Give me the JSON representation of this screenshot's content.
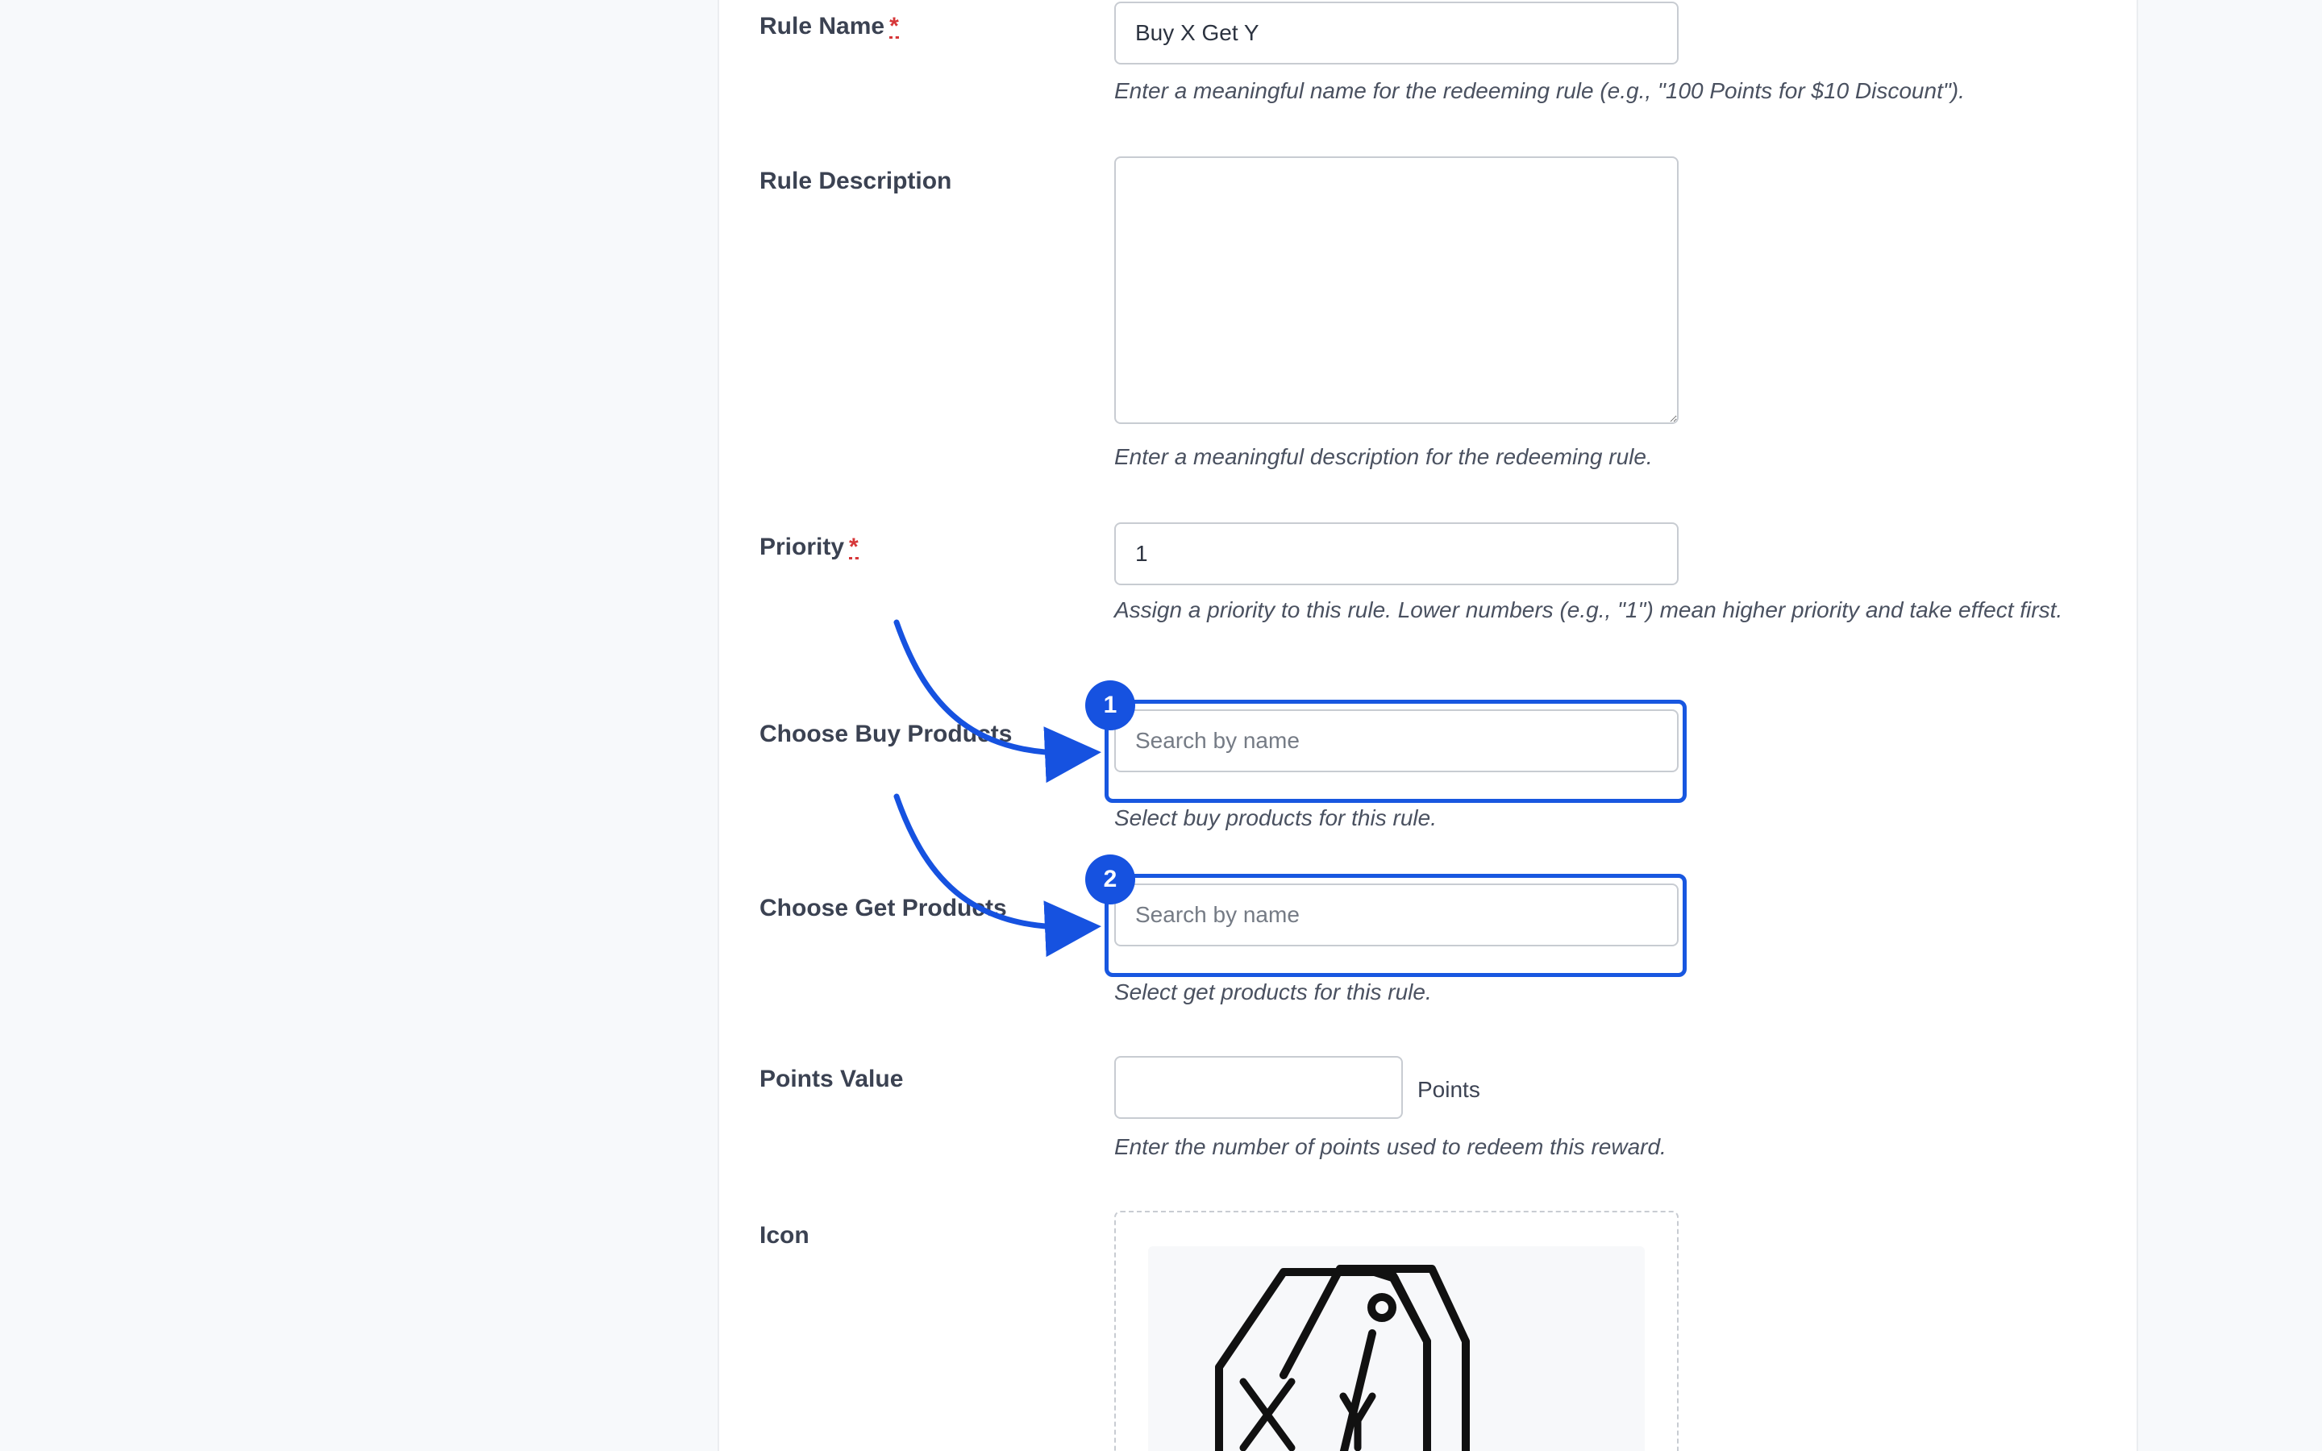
{
  "form": {
    "rule_name": {
      "label": "Rule Name",
      "required_mark": "*",
      "value": "Buy X Get Y",
      "help": "Enter a meaningful name for the redeeming rule (e.g., \"100 Points for $10 Discount\")."
    },
    "rule_description": {
      "label": "Rule Description",
      "value": "",
      "help": "Enter a meaningful description for the redeeming rule."
    },
    "priority": {
      "label": "Priority",
      "required_mark": "*",
      "value": "1",
      "help": "Assign a priority to this rule. Lower numbers (e.g., \"1\") mean higher priority and take effect first."
    },
    "buy_products": {
      "label": "Choose Buy Products",
      "placeholder": "Search by name",
      "help": "Select buy products for this rule.",
      "step_number": "1"
    },
    "get_products": {
      "label": "Choose Get Products",
      "placeholder": "Search by name",
      "help": "Select get products for this rule.",
      "step_number": "2"
    },
    "points_value": {
      "label": "Points Value",
      "value": "",
      "suffix": "Points",
      "help": "Enter the number of points used to redeem this reward."
    },
    "icon": {
      "label": "Icon",
      "preview_icon": "buy-x-get-y-tags-icon"
    }
  },
  "colors": {
    "accent": "#1652e0",
    "required": "#d63638",
    "page_background": "#f7f9fb"
  }
}
